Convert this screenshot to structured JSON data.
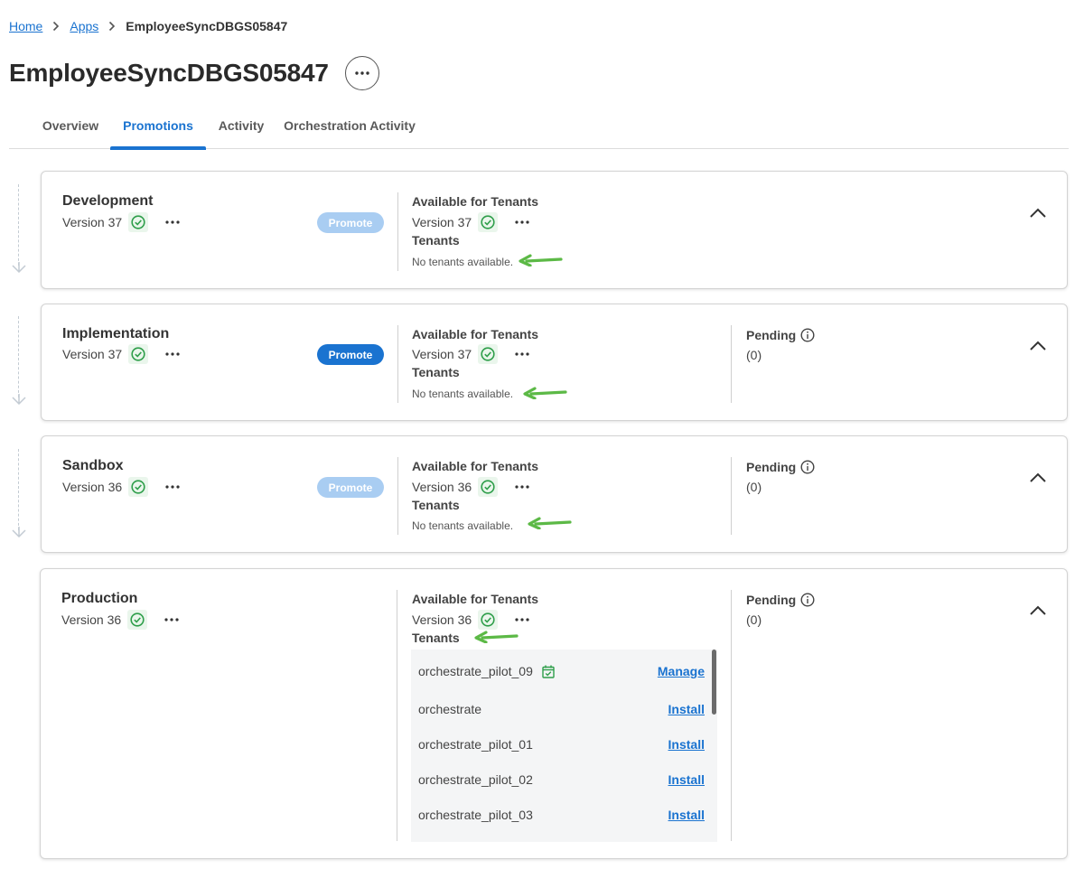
{
  "breadcrumb": {
    "home": "Home",
    "apps": "Apps",
    "current": "EmployeeSyncDBGS05847"
  },
  "page": {
    "title": "EmployeeSyncDBGS05847"
  },
  "tabs": [
    {
      "label": "Overview",
      "active": false
    },
    {
      "label": "Promotions",
      "active": true
    },
    {
      "label": "Activity",
      "active": false
    },
    {
      "label": "Orchestration Activity",
      "active": false
    }
  ],
  "labels": {
    "available": "Available for Tenants",
    "tenants": "Tenants",
    "no_tenants": "No tenants available.",
    "pending": "Pending",
    "promote": "Promote"
  },
  "environments": [
    {
      "name": "Development",
      "version": "Version 37",
      "available_version": "Version 37",
      "promote_enabled": false,
      "pending_count": null
    },
    {
      "name": "Implementation",
      "version": "Version 37",
      "available_version": "Version 37",
      "promote_enabled": true,
      "pending_count": "(0)"
    },
    {
      "name": "Sandbox",
      "version": "Version 36",
      "available_version": "Version 36",
      "promote_enabled": false,
      "pending_count": "(0)"
    },
    {
      "name": "Production",
      "version": "Version 36",
      "available_version": "Version 36",
      "promote_enabled": null,
      "pending_count": "(0)"
    }
  ],
  "production_tenants": [
    {
      "name": "orchestrate_pilot_09",
      "action": "Manage",
      "installed": true
    },
    {
      "name": "orchestrate",
      "action": "Install",
      "installed": false
    },
    {
      "name": "orchestrate_pilot_01",
      "action": "Install",
      "installed": false
    },
    {
      "name": "orchestrate_pilot_02",
      "action": "Install",
      "installed": false
    },
    {
      "name": "orchestrate_pilot_03",
      "action": "Install",
      "installed": false
    }
  ],
  "colors": {
    "accent": "#1a73d0",
    "success": "#2e9e4a",
    "annotation_arrow": "#5cb946",
    "promote_disabled": "#a9cdf2"
  },
  "icons": {
    "check": "check-circle-icon",
    "more": "ellipsis-icon",
    "info": "info-circle-icon",
    "collapse": "chevron-up-icon",
    "installed": "calendar-check-icon",
    "separator": "chevron-right-icon"
  }
}
